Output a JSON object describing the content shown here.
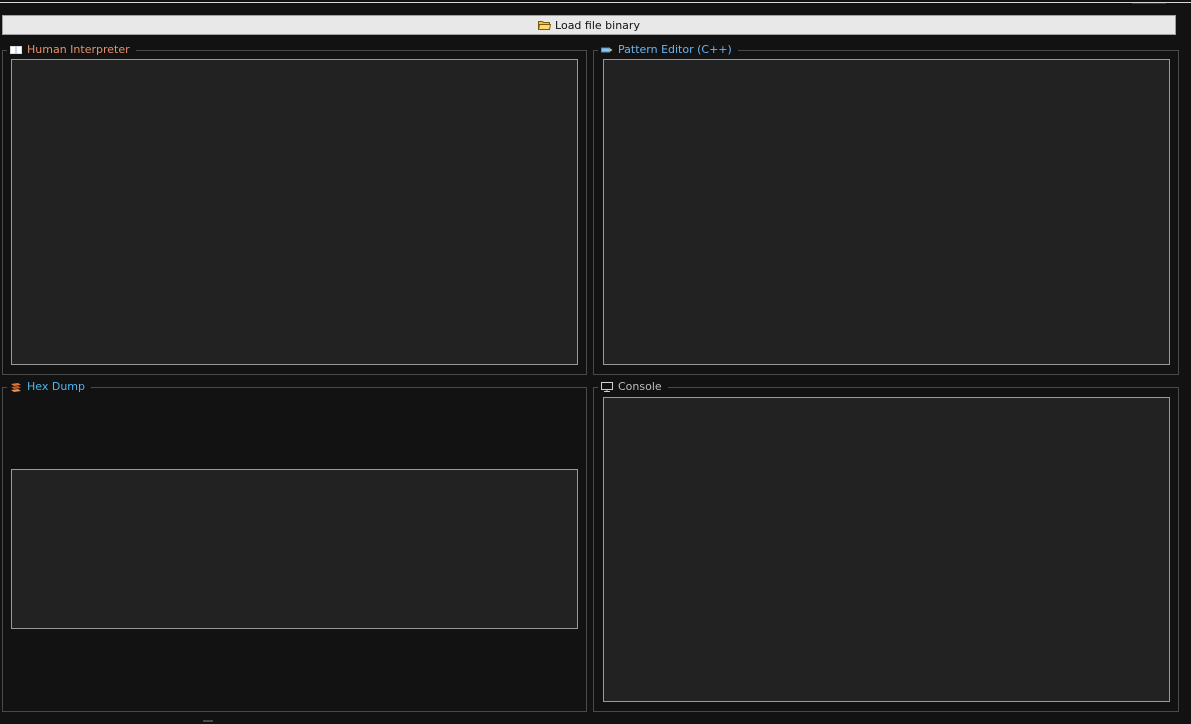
{
  "toolbar": {
    "load_label": "Load file binary",
    "load_icon": "folder-icon"
  },
  "panels": {
    "human_interpreter": {
      "title": "Human Interpreter",
      "icon": "book-icon",
      "title_color": "#e8916a",
      "content": ""
    },
    "pattern_editor": {
      "title": "Pattern Editor (C++)",
      "icon": "pencil-icon",
      "title_color": "#6ab4f0",
      "content": ""
    },
    "hex_dump": {
      "title": "Hex Dump",
      "icon": "stack-icon",
      "title_color": "#4fb6ea",
      "content": ""
    },
    "console": {
      "title": "Console",
      "icon": "monitor-icon",
      "title_color": "#bdbdbd",
      "content": ""
    }
  },
  "colors": {
    "background": "#121212",
    "panel_fill": "#222222",
    "button_fill": "#e8e8e8"
  }
}
